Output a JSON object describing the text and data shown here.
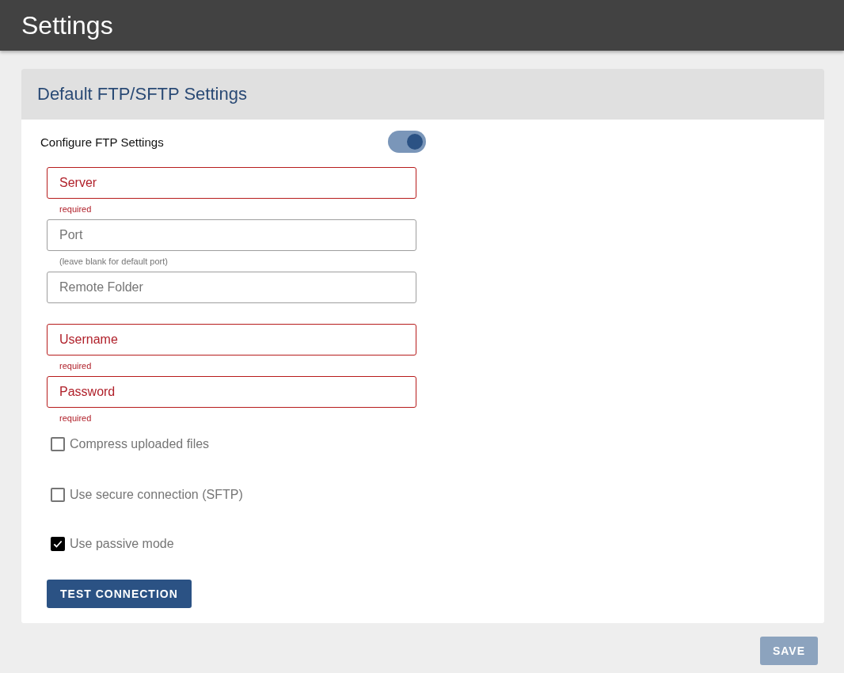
{
  "header": {
    "title": "Settings"
  },
  "section": {
    "title": "Default FTP/SFTP Settings",
    "toggle": {
      "label": "Configure FTP Settings",
      "on": true
    },
    "fields": [
      {
        "placeholder": "Server",
        "invalid": true,
        "hint": "required"
      },
      {
        "placeholder": "Port",
        "invalid": false,
        "hint": "(leave blank for default port)"
      },
      {
        "placeholder": "Remote Folder",
        "invalid": false
      },
      {
        "placeholder": "Username",
        "invalid": true,
        "hint": "required"
      },
      {
        "placeholder": "Password",
        "invalid": true,
        "hint": "required"
      }
    ],
    "checkboxes": [
      {
        "label": "Compress uploaded files",
        "checked": false
      },
      {
        "label": "Use secure connection (SFTP)",
        "checked": false
      },
      {
        "label": "Use passive mode",
        "checked": true
      }
    ],
    "test_button": {
      "label": "TEST CONNECTION"
    }
  },
  "save_button": {
    "label": "SAVE",
    "disabled": true
  }
}
